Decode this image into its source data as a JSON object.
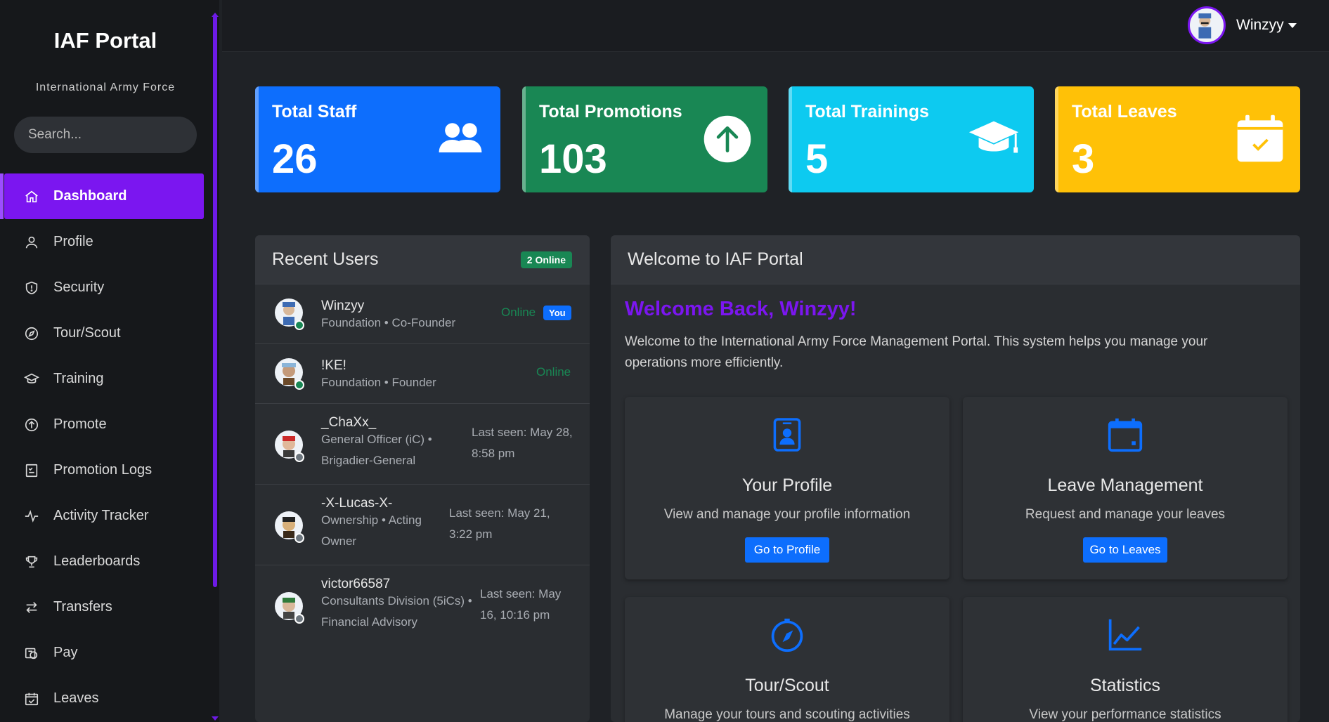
{
  "sidebar": {
    "title": "IAF Portal",
    "subtitle": "International Army Force",
    "search_placeholder": "Search...",
    "items": [
      {
        "label": "Dashboard",
        "icon": "home-icon"
      },
      {
        "label": "Profile",
        "icon": "user-icon"
      },
      {
        "label": "Security",
        "icon": "shield-icon"
      },
      {
        "label": "Tour/Scout",
        "icon": "compass-icon"
      },
      {
        "label": "Training",
        "icon": "graduation-cap-icon"
      },
      {
        "label": "Promote",
        "icon": "arrow-up-circle-icon"
      },
      {
        "label": "Promotion Logs",
        "icon": "checklist-icon"
      },
      {
        "label": "Activity Tracker",
        "icon": "activity-icon"
      },
      {
        "label": "Leaderboards",
        "icon": "trophy-icon"
      },
      {
        "label": "Transfers",
        "icon": "transfer-icon"
      },
      {
        "label": "Pay",
        "icon": "cash-icon"
      },
      {
        "label": "Leaves",
        "icon": "calendar-check-icon"
      }
    ],
    "active_index": 0,
    "accent_color": "#7b16f0"
  },
  "topbar": {
    "user_name": "Winzyy"
  },
  "stats": [
    {
      "label": "Total Staff",
      "value": "26",
      "color": "#0d6efd",
      "icon": "people-icon"
    },
    {
      "label": "Total Promotions",
      "value": "103",
      "color": "#198754",
      "icon": "arrow-up-circle-icon"
    },
    {
      "label": "Total Trainings",
      "value": "5",
      "color": "#0dcaf0",
      "icon": "graduation-cap-icon"
    },
    {
      "label": "Total Leaves",
      "value": "3",
      "color": "#ffc107",
      "icon": "calendar-check-icon"
    }
  ],
  "recent_users": {
    "title": "Recent Users",
    "online_badge": "2 Online",
    "users": [
      {
        "name": "Winzyy",
        "role": "Foundation • Co-Founder",
        "status": "Online",
        "online": true,
        "you": "You"
      },
      {
        "name": "!KE!",
        "role": "Foundation • Founder",
        "status": "Online",
        "online": true
      },
      {
        "name": "_ChaXx_",
        "role_line1": "General Officer (iC) •",
        "role_line2": "Brigadier-General",
        "status_line1": "Last seen: May 28,",
        "status_line2": "8:58 pm",
        "online": false
      },
      {
        "name": "-X-Lucas-X-",
        "role_line1": "Ownership • Acting",
        "role_line2": "Owner",
        "status_line1": "Last seen: May 21,",
        "status_line2": "3:22 pm",
        "online": false
      },
      {
        "name": "victor66587",
        "role_line1": "Consultants Division (5iCs) •",
        "role_line2": "Financial Advisory",
        "status_line1": "Last seen: May",
        "status_line2": "16, 10:16 pm",
        "online": false
      }
    ]
  },
  "welcome": {
    "header": "Welcome to IAF Portal",
    "greeting": "Welcome Back, Winzyy!",
    "text": "Welcome to the International Army Force Management Portal. This system helps you manage your operations more efficiently.",
    "features": [
      {
        "title": "Your Profile",
        "desc": "View and manage your profile information",
        "button": "Go to Profile",
        "icon": "id-badge-icon"
      },
      {
        "title": "Leave Management",
        "desc": "Request and manage your leaves",
        "button": "Go to Leaves",
        "icon": "calendar-icon"
      },
      {
        "title": "Tour/Scout",
        "desc": "Manage your tours and scouting activities",
        "icon": "compass-icon"
      },
      {
        "title": "Statistics",
        "desc": "View your performance statistics",
        "icon": "line-chart-icon"
      }
    ]
  }
}
